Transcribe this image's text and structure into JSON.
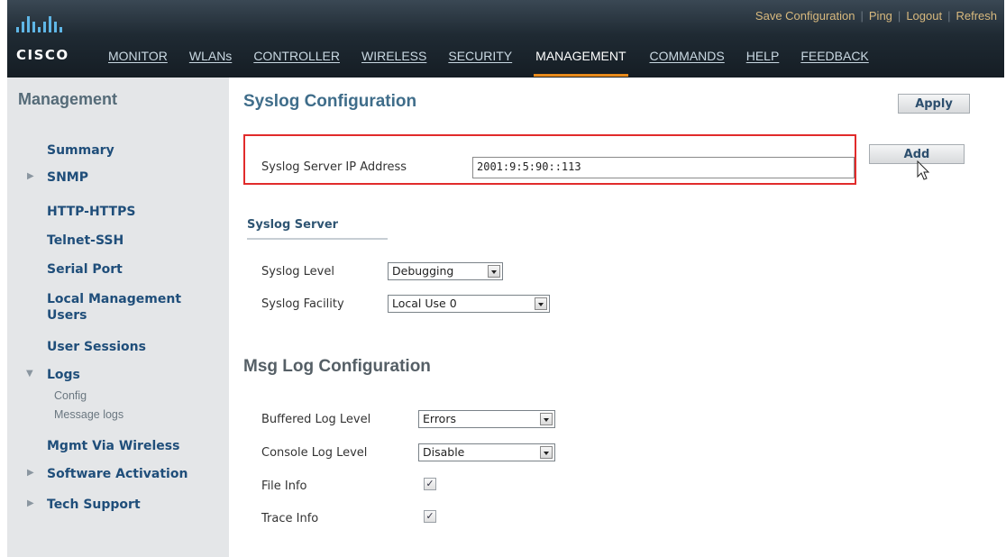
{
  "header": {
    "logo_text": "CISCO",
    "top_links": [
      "Save Configuration",
      "Ping",
      "Logout",
      "Refresh"
    ],
    "nav": [
      "MONITOR",
      "WLANs",
      "CONTROLLER",
      "WIRELESS",
      "SECURITY",
      "MANAGEMENT",
      "COMMANDS",
      "HELP",
      "FEEDBACK"
    ],
    "active_nav": "MANAGEMENT"
  },
  "sidebar": {
    "title": "Management",
    "items": [
      {
        "label": "Summary"
      },
      {
        "label": "SNMP",
        "icon": "triangle-right"
      },
      {
        "label": "HTTP-HTTPS"
      },
      {
        "label": "Telnet-SSH"
      },
      {
        "label": "Serial Port"
      },
      {
        "label": "Local Management Users"
      },
      {
        "label": "User Sessions"
      },
      {
        "label": "Logs",
        "icon": "triangle-down"
      },
      {
        "label": "Mgmt Via Wireless"
      },
      {
        "label": "Software Activation",
        "icon": "triangle-right"
      },
      {
        "label": "Tech Support",
        "icon": "triangle-right"
      }
    ],
    "logs_subitems": [
      "Config",
      "Message logs"
    ]
  },
  "main": {
    "title": "Syslog Configuration",
    "apply_label": "Apply",
    "add_label": "Add",
    "syslog_ip_label": "Syslog Server IP Address",
    "syslog_ip_value": "2001:9:5:90::113",
    "syslog_server_tab": "Syslog Server",
    "syslog_level_label": "Syslog Level",
    "syslog_level_value": "Debugging",
    "syslog_facility_label": "Syslog Facility",
    "syslog_facility_value": "Local Use 0",
    "msg_log_title": "Msg Log Configuration",
    "buffered_log_label": "Buffered Log Level",
    "buffered_log_value": "Errors",
    "console_log_label": "Console Log Level",
    "console_log_value": "Disable",
    "file_info_label": "File Info",
    "file_info_checked": true,
    "trace_info_label": "Trace Info",
    "trace_info_checked": true
  },
  "colors": {
    "header_bg": "#1f2a33",
    "active_underline": "#e88a1a",
    "sidebar_bg": "#e4e6e8",
    "highlight_box": "#e12b2b",
    "link_blue": "#1f4e7a"
  }
}
